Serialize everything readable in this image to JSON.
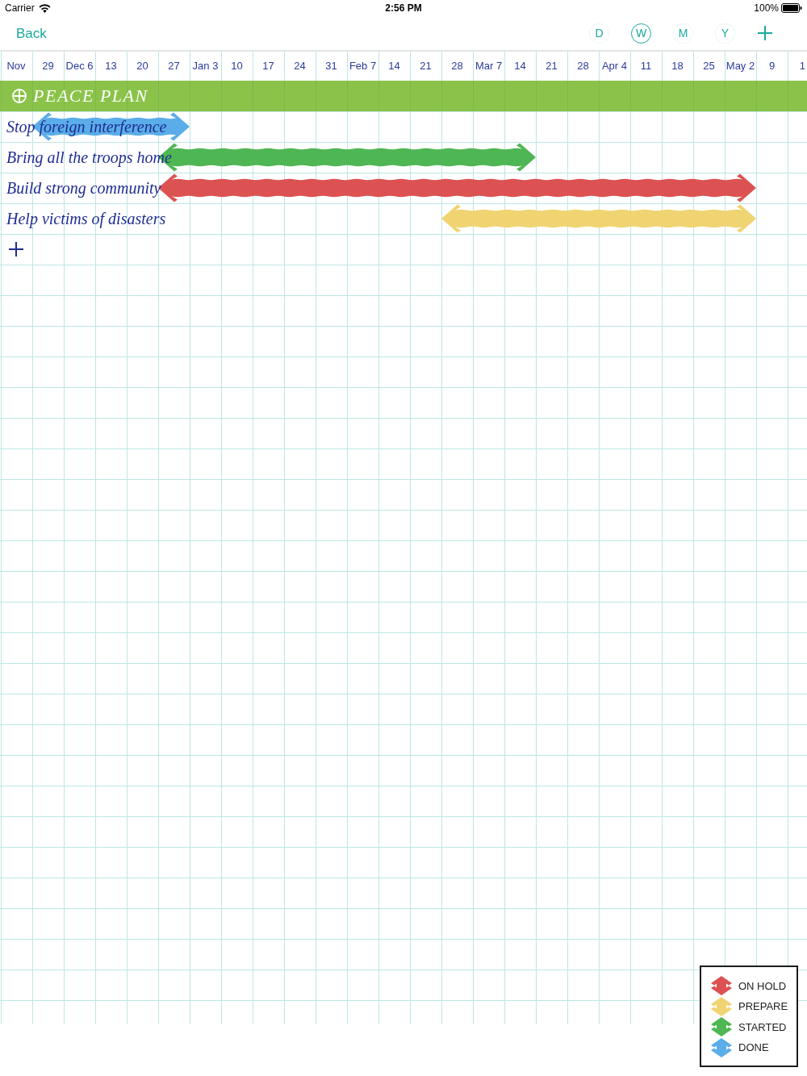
{
  "status_bar": {
    "carrier": "Carrier",
    "time": "2:56 PM",
    "battery": "100%"
  },
  "nav_bar": {
    "back": "Back",
    "zoom_levels": [
      {
        "label": "D",
        "selected": false
      },
      {
        "label": "W",
        "selected": true
      },
      {
        "label": "M",
        "selected": false
      },
      {
        "label": "Y",
        "selected": false
      }
    ]
  },
  "timeline": {
    "dates": [
      "Nov",
      "29",
      "Dec 6",
      "13",
      "20",
      "27",
      "Jan 3",
      "10",
      "17",
      "24",
      "31",
      "Feb 7",
      "14",
      "21",
      "28",
      "Mar 7",
      "14",
      "21",
      "28",
      "Apr 4",
      "11",
      "18",
      "25",
      "May 2",
      "9",
      "1"
    ]
  },
  "project": {
    "title": "PEACE PLAN",
    "tasks": [
      {
        "name": "Stop foreign interference",
        "color": "#5aade8"
      },
      {
        "name": "Bring all the troops home",
        "color": "#4fb654"
      },
      {
        "name": "Build strong community",
        "color": "#dc5252"
      },
      {
        "name": "Help victims of disasters",
        "color": "#f0d472"
      }
    ]
  },
  "legend": [
    {
      "label": "ON HOLD",
      "color": "#dc5252"
    },
    {
      "label": "PREPARE",
      "color": "#f0d472"
    },
    {
      "label": "STARTED",
      "color": "#4fb654"
    },
    {
      "label": "DONE",
      "color": "#5aade8"
    }
  ]
}
